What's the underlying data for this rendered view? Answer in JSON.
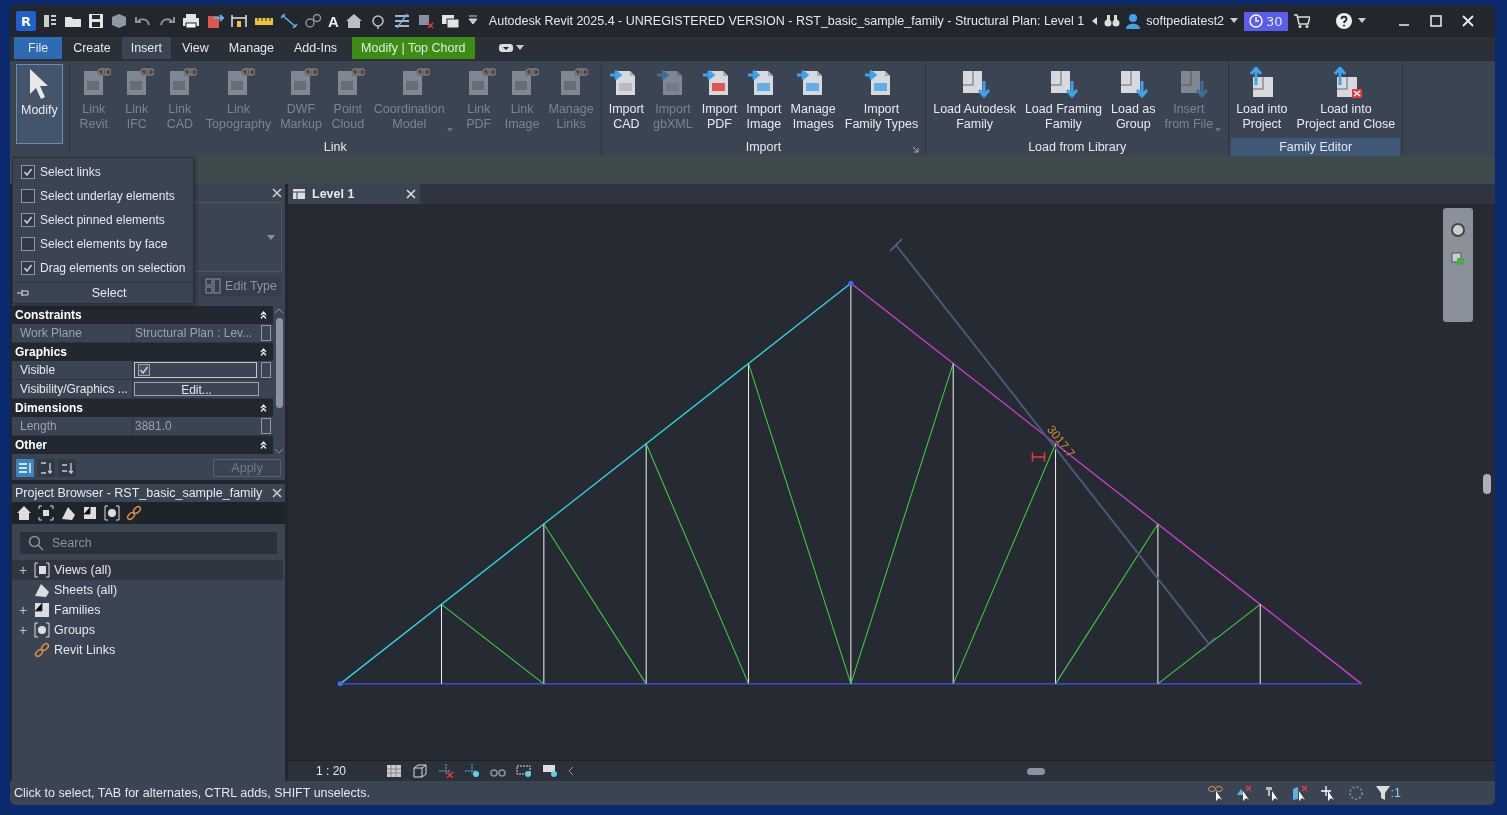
{
  "window": {
    "logo": "R",
    "text_tool": "A",
    "title": "Autodesk Revit 2025.4 - UNREGISTERED VERSION - RST_basic_sample_family - Structural Plan: Level 1",
    "user": "softpediatest2",
    "trial_days": "30"
  },
  "ribbon_tabs": [
    {
      "label": "File",
      "kind": "file",
      "selected": false
    },
    {
      "label": "Create",
      "kind": "tab",
      "selected": false
    },
    {
      "label": "Insert",
      "kind": "tab",
      "selected": true
    },
    {
      "label": "View",
      "kind": "tab",
      "selected": false
    },
    {
      "label": "Manage",
      "kind": "tab",
      "selected": false
    },
    {
      "label": "Add-Ins",
      "kind": "tab",
      "selected": false
    },
    {
      "label": "Modify | Top Chord",
      "kind": "contextual",
      "selected": false
    }
  ],
  "modify_tool": {
    "label": "Modify",
    "selected": true
  },
  "ribbon_panels": [
    {
      "title": "Link",
      "highlighted": false,
      "launcher": false,
      "tools": [
        {
          "label": "Link\nRevit",
          "disabled": true,
          "dropdown": false
        },
        {
          "label": "Link\nIFC",
          "disabled": true,
          "dropdown": false
        },
        {
          "label": "Link\nCAD",
          "disabled": true,
          "dropdown": false
        },
        {
          "label": "Link\nTopography",
          "disabled": true,
          "dropdown": false
        },
        {
          "label": "DWF\nMarkup",
          "disabled": true,
          "dropdown": false
        },
        {
          "label": "Point\nCloud",
          "disabled": true,
          "dropdown": false
        },
        {
          "label": "Coordination\nModel",
          "disabled": true,
          "dropdown": true
        },
        {
          "label": "Link\nPDF",
          "disabled": true,
          "dropdown": false
        },
        {
          "label": "Link\nImage",
          "disabled": true,
          "dropdown": false
        },
        {
          "label": "Manage\nLinks",
          "disabled": true,
          "dropdown": false
        }
      ]
    },
    {
      "title": "Import",
      "highlighted": false,
      "launcher": true,
      "tools": [
        {
          "label": "Import\nCAD",
          "disabled": false,
          "dropdown": false
        },
        {
          "label": "Import\ngbXML",
          "disabled": true,
          "dropdown": false
        },
        {
          "label": "Import\nPDF",
          "disabled": false,
          "dropdown": false
        },
        {
          "label": "Import\nImage",
          "disabled": false,
          "dropdown": false
        },
        {
          "label": "Manage\nImages",
          "disabled": false,
          "dropdown": false
        },
        {
          "label": "Import\nFamily Types",
          "disabled": false,
          "dropdown": false
        }
      ]
    },
    {
      "title": "Load from Library",
      "highlighted": false,
      "launcher": false,
      "tools": [
        {
          "label": "Load Autodesk\nFamily",
          "disabled": false,
          "dropdown": false
        },
        {
          "label": "Load Framing\nFamily",
          "disabled": false,
          "dropdown": false
        },
        {
          "label": "Load as\nGroup",
          "disabled": false,
          "dropdown": false
        },
        {
          "label": "Insert\nfrom File",
          "disabled": true,
          "dropdown": true
        }
      ]
    },
    {
      "title": "Family Editor",
      "highlighted": true,
      "launcher": false,
      "tools": [
        {
          "label": "Load into\nProject",
          "disabled": false,
          "dropdown": false
        },
        {
          "label": "Load into\nProject and Close",
          "disabled": false,
          "dropdown": false
        }
      ]
    }
  ],
  "select_menu": {
    "items": [
      {
        "label": "Select links",
        "checked": true
      },
      {
        "label": "Select underlay elements",
        "checked": false
      },
      {
        "label": "Select pinned elements",
        "checked": true
      },
      {
        "label": "Select elements by face",
        "checked": false
      },
      {
        "label": "Drag elements on selection",
        "checked": true
      }
    ],
    "title": "Select"
  },
  "properties": {
    "edit_type": "Edit Type",
    "groups": [
      {
        "title": "Constraints",
        "rows": [
          {
            "name": "Work Plane",
            "kind": "readonly",
            "value": "Structural Plan : Lev..."
          }
        ]
      },
      {
        "title": "Graphics",
        "rows": [
          {
            "name": "Visible",
            "kind": "checkbox",
            "checked": true
          },
          {
            "name": "Visibility/Graphics ...",
            "kind": "button",
            "value": "Edit..."
          }
        ]
      },
      {
        "title": "Dimensions",
        "rows": [
          {
            "name": "Length",
            "kind": "readonly",
            "value": "3881.0"
          }
        ]
      },
      {
        "title": "Other"
      }
    ],
    "apply": {
      "label": "Apply",
      "disabled": true
    }
  },
  "project_browser": {
    "title": "Project Browser - RST_basic_sample_family",
    "search_placeholder": "Search",
    "items": [
      {
        "label": "Views (all)",
        "toggle": "+",
        "selected": true
      },
      {
        "label": "Sheets (all)",
        "selected": false
      },
      {
        "label": "Families",
        "toggle": "+",
        "selected": false
      },
      {
        "label": "Groups",
        "toggle": "+",
        "selected": false
      },
      {
        "label": "Revit Links",
        "selected": false
      }
    ]
  },
  "view": {
    "tab": "Level 1",
    "dimension": "3017.7",
    "scale": "1 : 20"
  },
  "status_bar": {
    "text": "Click to select, TAB for alternates, CTRL adds, SHIFT unselects.",
    "filter_count": ":1"
  }
}
